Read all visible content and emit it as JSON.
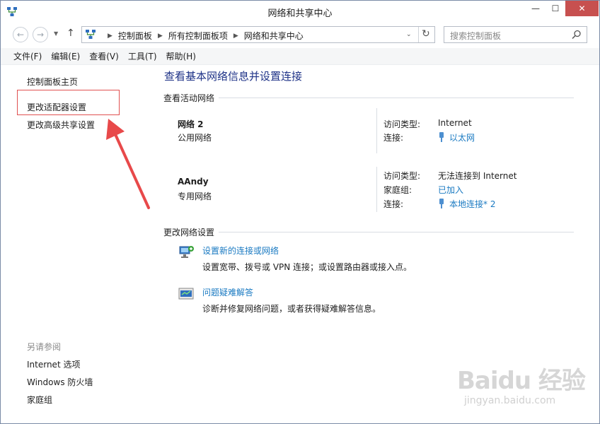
{
  "window": {
    "title": "网络和共享中心",
    "minimize": "—",
    "maximize": "☐",
    "close": "✕"
  },
  "address": {
    "crumbs": [
      "控制面板",
      "所有控制面板项",
      "网络和共享中心"
    ],
    "search_placeholder": "搜索控制面板"
  },
  "menu": [
    "文件(F)",
    "编辑(E)",
    "查看(V)",
    "工具(T)",
    "帮助(H)"
  ],
  "sidebar": {
    "links": [
      "控制面板主页",
      "更改适配器设置",
      "更改高级共享设置"
    ],
    "see_also_header": "另请参阅",
    "see_also": [
      "Internet 选项",
      "Windows 防火墙",
      "家庭组"
    ]
  },
  "main": {
    "title": "查看基本网络信息并设置连接",
    "active_header": "查看活动网络",
    "networks": [
      {
        "name": "网络  2",
        "type": "公用网络",
        "access_label": "访问类型:",
        "access_value": "Internet",
        "conn_label": "连接:",
        "conn_value": "以太网"
      },
      {
        "name": "AAndy",
        "type": "专用网络",
        "access_label": "访问类型:",
        "access_value": "无法连接到 Internet",
        "homegroup_label": "家庭组:",
        "homegroup_value": "已加入",
        "conn_label": "连接:",
        "conn_value": "本地连接* 2"
      }
    ],
    "change_header": "更改网络设置",
    "tasks": [
      {
        "link": "设置新的连接或网络",
        "desc": "设置宽带、拨号或 VPN 连接；或设置路由器或接入点。"
      },
      {
        "link": "问题疑难解答",
        "desc": "诊断并修复网络问题，或者获得疑难解答信息。"
      }
    ]
  },
  "watermark": {
    "main": "Baidu 经验",
    "sub": "jingyan.baidu.com"
  },
  "colors": {
    "title_blue": "#1e3287",
    "link_blue": "#1a7ac2",
    "close_red": "#c7504f",
    "annotation_red": "#e05050"
  }
}
